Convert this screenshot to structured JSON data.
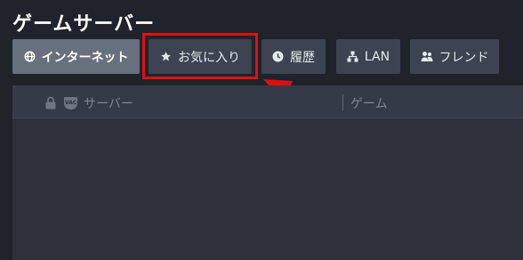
{
  "header": {
    "title": "ゲームサーバー"
  },
  "tabs": [
    {
      "label": "インターネット",
      "icon": "globe-icon",
      "active": true
    },
    {
      "label": "お気に入り",
      "icon": "star-icon",
      "active": false
    },
    {
      "label": "履歴",
      "icon": "clock-icon",
      "active": false
    },
    {
      "label": "LAN",
      "icon": "lan-icon",
      "active": false
    },
    {
      "label": "フレンド",
      "icon": "friends-icon",
      "active": false
    }
  ],
  "table": {
    "vac_label": "VAC",
    "columns": {
      "server": "サーバー",
      "game": "ゲーム"
    }
  },
  "colors": {
    "background": "#1f232b",
    "tab": "#3d4350",
    "tab_active": "#67707c",
    "highlight": "#e01010"
  }
}
